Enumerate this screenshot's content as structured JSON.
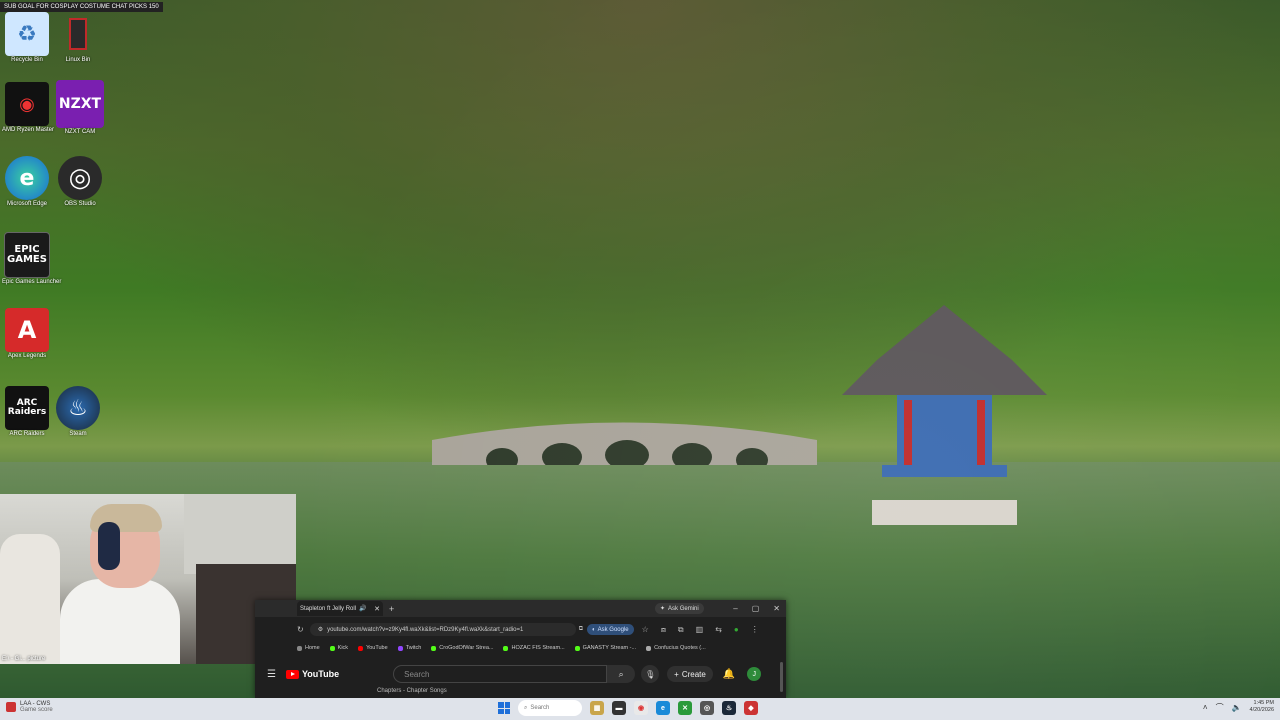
{
  "stream_label": "SUB GOAL FOR COSPLAY COSTUME CHAT PICKS 150",
  "desktop_icons": [
    {
      "label": "Recycle Bin",
      "glyph": "♻",
      "color": "#cfe7ff"
    },
    {
      "label": "Linux Bin",
      "glyph": "▮",
      "color": "#2a2a2a"
    },
    {
      "label": "AMD Ryzen Master",
      "glyph": "◉",
      "color": "#1a1a1a"
    },
    {
      "label": "NZXT CAM",
      "glyph": "NZXT",
      "color": "#7a1fb0"
    },
    {
      "label": "Microsoft Edge",
      "glyph": "e",
      "color": "#1a8ad8"
    },
    {
      "label": "OBS Studio",
      "glyph": "◎",
      "color": "#2a2a2a"
    },
    {
      "label": "Epic Games Launcher",
      "glyph": "EPIC GAMES",
      "color": "#1a1a1a"
    },
    {
      "label": "Apex Legends",
      "glyph": "A",
      "color": "#d62a2a"
    },
    {
      "label": "ARC Raiders",
      "glyph": "ARC Raiders",
      "color": "#1a1a1a"
    },
    {
      "label": "Steam",
      "glyph": "♨",
      "color": "#1b2838"
    }
  ],
  "webcam_caption": "E:\\ - Gl... picture",
  "browser": {
    "tab_title": "Stapleton ft Jelly Roll",
    "ask_gemini": "Ask Gemini",
    "url": "youtube.com/watch?v=z9Ky4fl.waXk&list=RDz9Ky4fl.waXk&start_radio=1",
    "ask_google": "Ask Google",
    "bookmarks": [
      {
        "label": "Home",
        "color": "#888888"
      },
      {
        "label": "Kick",
        "color": "#53fc18"
      },
      {
        "label": "YouTube",
        "color": "#ff0000"
      },
      {
        "label": "Twitch",
        "color": "#9146ff"
      },
      {
        "label": "CroGodOfWar Strea...",
        "color": "#53fc18"
      },
      {
        "label": "HOZAC FIS Stream...",
        "color": "#53fc18"
      },
      {
        "label": "GANASTY Stream -...",
        "color": "#53fc18"
      },
      {
        "label": "Confucius Quotes (...",
        "color": "#aaaaaa"
      }
    ],
    "yt_logo": "YouTube",
    "search_placeholder": "Search",
    "create_label": "Create",
    "avatar_letter": "J",
    "subline": "Chapters - Chapter Songs"
  },
  "taskbar": {
    "weather_line1": "LAA - CWS",
    "weather_line2": "Game score",
    "search_label": "Search",
    "time": "1:45 PM",
    "date": "4/20/2026"
  }
}
